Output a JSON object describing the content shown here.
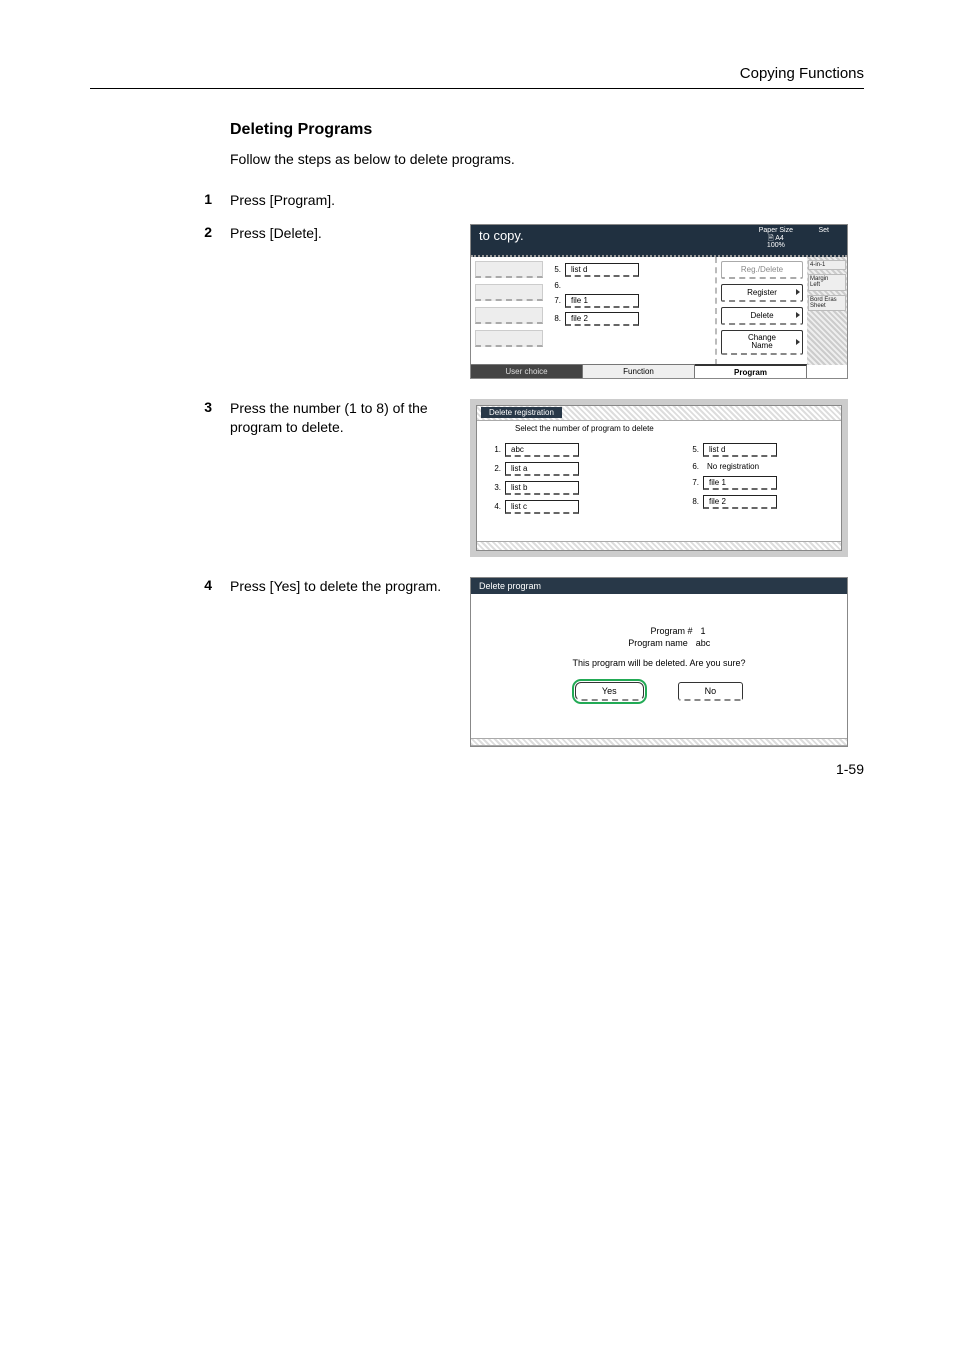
{
  "header": {
    "title": "Copying Functions"
  },
  "section": {
    "title": "Deleting Programs",
    "intro": "Follow the steps as below to delete programs."
  },
  "steps": {
    "s1": {
      "num": "1",
      "text": "Press [Program]."
    },
    "s2": {
      "num": "2",
      "text": "Press [Delete]."
    },
    "s3": {
      "num": "3",
      "text": "Press the number (1 to 8) of the program to delete."
    },
    "s4": {
      "num": "4",
      "text": "Press [Yes] to delete the program."
    }
  },
  "panelA": {
    "title": "to copy.",
    "paperSizeLabel": "Paper Size",
    "paperSize": "A4",
    "zoom": "100%",
    "setLabel": "Set",
    "list": {
      "i5n": "5.",
      "i5l": "list d",
      "i6n": "6.",
      "i7n": "7.",
      "i7l": "file 1",
      "i8n": "8.",
      "i8l": "file 2"
    },
    "right": {
      "regDelete": "Reg./Delete",
      "register": "Register",
      "delete": "Delete",
      "changeName": "Change\nName"
    },
    "side": {
      "a": "4-in-1",
      "b": "Margin\nLeft",
      "c": "Bord Eras\nSheet"
    },
    "tabs": {
      "t1": "User choice",
      "t2": "Function",
      "t3": "Program"
    }
  },
  "panelB": {
    "title": "Delete registration",
    "prompt": "Select the number of program to delete",
    "left": {
      "i1n": "1.",
      "i1l": "abc",
      "i2n": "2.",
      "i2l": "list a",
      "i3n": "3.",
      "i3l": "list b",
      "i4n": "4.",
      "i4l": "list c"
    },
    "right": {
      "i5n": "5.",
      "i5l": "list d",
      "i6n": "6.",
      "i6l": "No registration",
      "i7n": "7.",
      "i7l": "file 1",
      "i8n": "8.",
      "i8l": "file 2"
    }
  },
  "panelC": {
    "title": "Delete program",
    "kv": {
      "k1": "Program #",
      "v1": "1",
      "k2": "Program name",
      "v2": "abc"
    },
    "confirm": "This program will be deleted. Are you sure?",
    "yes": "Yes",
    "no": "No"
  },
  "pageNumber": "1-59"
}
